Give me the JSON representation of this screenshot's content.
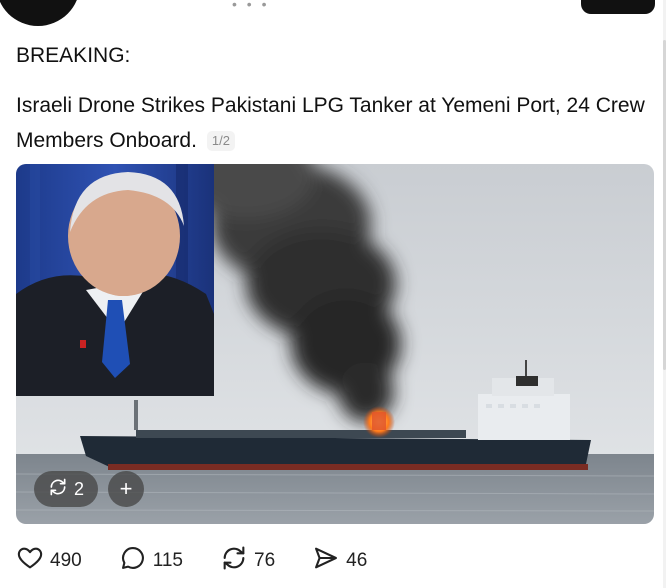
{
  "post": {
    "label": "BREAKING:",
    "headline": "Israeli Drone Strikes Pakistani LPG Tanker at Yemeni Port, 24 Crew Members Onboard.",
    "image_counter": "1/2"
  },
  "media": {
    "repost_count": "2",
    "add_label": "+"
  },
  "actions": {
    "likes": "490",
    "replies": "115",
    "reposts": "76",
    "shares": "46"
  },
  "icons": [
    "heart-icon",
    "comment-icon",
    "repost-icon",
    "share-icon",
    "add-icon"
  ]
}
